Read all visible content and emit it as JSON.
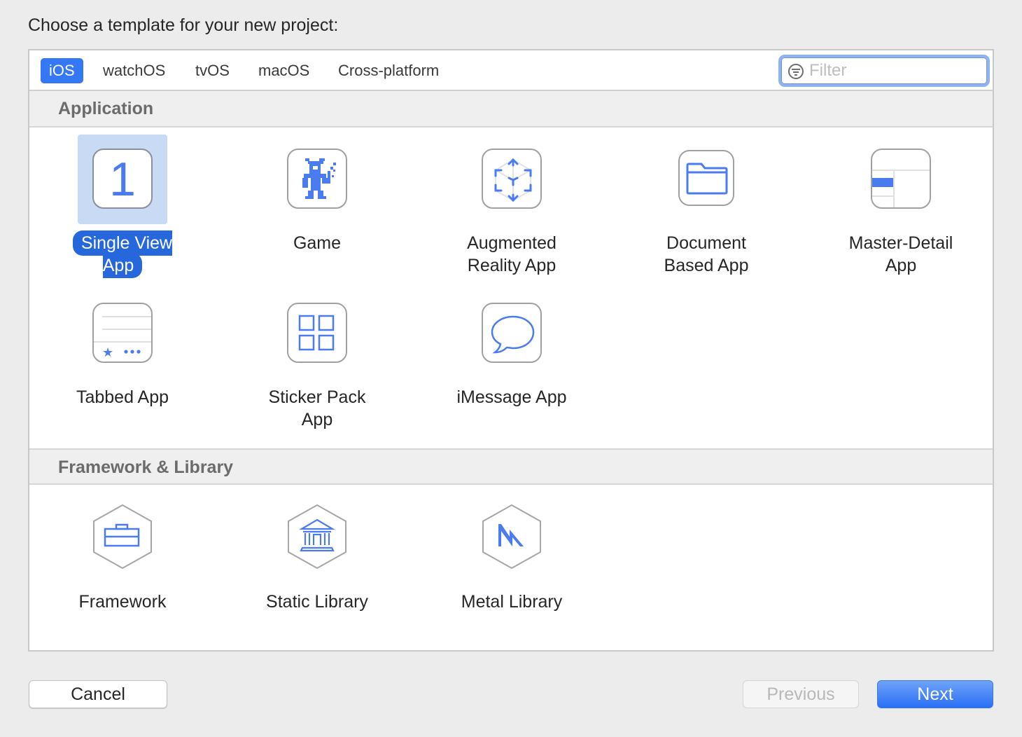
{
  "prompt": "Choose a template for your new project:",
  "tabs": [
    {
      "label": "iOS",
      "active": true
    },
    {
      "label": "watchOS",
      "active": false
    },
    {
      "label": "tvOS",
      "active": false
    },
    {
      "label": "macOS",
      "active": false
    },
    {
      "label": "Cross-platform",
      "active": false
    }
  ],
  "filter": {
    "placeholder": "Filter",
    "value": "",
    "icon": "filter-icon"
  },
  "sections": [
    {
      "title": "Application",
      "templates": [
        {
          "label": "Single View App",
          "icon": "single-view-icon",
          "selected": true,
          "glyph": "1"
        },
        {
          "label": "Game",
          "icon": "game-icon",
          "selected": false
        },
        {
          "label": "Augmented Reality App",
          "icon": "ar-cube-icon",
          "selected": false
        },
        {
          "label": "Document Based App",
          "icon": "folder-icon",
          "selected": false
        },
        {
          "label": "Master-Detail App",
          "icon": "master-detail-icon",
          "selected": false
        },
        {
          "label": "Tabbed App",
          "icon": "tabbed-icon",
          "selected": false
        },
        {
          "label": "Sticker Pack App",
          "icon": "sticker-grid-icon",
          "selected": false
        },
        {
          "label": "iMessage App",
          "icon": "message-bubble-icon",
          "selected": false
        }
      ]
    },
    {
      "title": "Framework & Library",
      "templates": [
        {
          "label": "Framework",
          "icon": "briefcase-icon",
          "selected": false
        },
        {
          "label": "Static Library",
          "icon": "library-building-icon",
          "selected": false
        },
        {
          "label": "Metal Library",
          "icon": "metal-icon",
          "selected": false
        }
      ]
    }
  ],
  "buttons": {
    "cancel": "Cancel",
    "previous": "Previous",
    "next": "Next"
  },
  "colors": {
    "accent": "#3478f6",
    "selection": "#2667db",
    "icon_blue": "#4a7cf0"
  }
}
